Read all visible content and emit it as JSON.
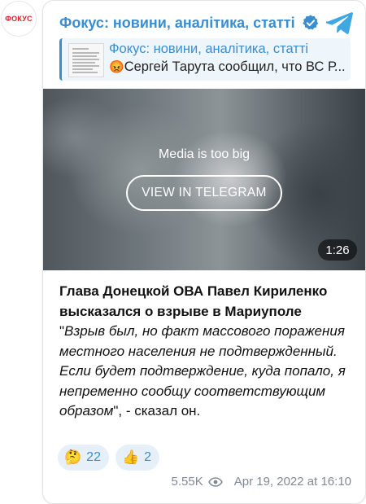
{
  "avatar": {
    "text": "ФОКУС"
  },
  "channel": {
    "title": "Фокус: новини, аналітика, статті"
  },
  "reply": {
    "title": "Фокус: новини, аналітика, статті",
    "emoji": "😡",
    "text": "Сергей Тарута сообщил, что ВС Р..."
  },
  "media": {
    "message": "Media is too big",
    "button_label": "VIEW IN TELEGRAM",
    "duration": "1:26"
  },
  "post": {
    "headline": "Глава Донецкой ОВА Павел Кириленко высказался о взрыве в Мариуполе",
    "quote_open": "\"",
    "quote": "Взрыв был, но факт массового поражения местного населения не подтвержденный. Если будет подтверждение, куда попало, я непременно сообщу соответствующим образом",
    "tail": "\", - сказал он."
  },
  "reactions": [
    {
      "emoji": "🤔",
      "count": "22",
      "icon": "thinking-face-icon"
    },
    {
      "emoji": "👍",
      "count": "2",
      "icon": "thumbs-up-icon"
    }
  ],
  "footer": {
    "views": "5.55K",
    "date": "Apr 19, 2022 at 16:10"
  },
  "colors": {
    "accent": "#3a8ed0",
    "avatar_text": "#d8232a"
  }
}
